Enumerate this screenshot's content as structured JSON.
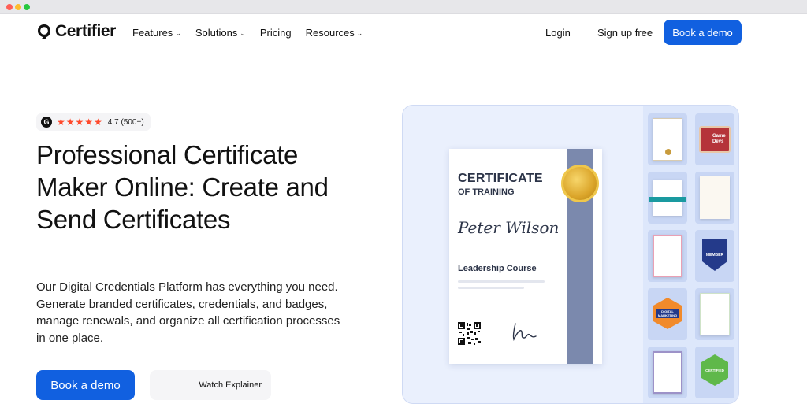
{
  "browser": {
    "dots": [
      "#ff5f57",
      "#febc2e",
      "#28c840"
    ]
  },
  "nav": {
    "logo_text": "Certifier",
    "menu": [
      {
        "label": "Features",
        "has_dropdown": true
      },
      {
        "label": "Solutions",
        "has_dropdown": true
      },
      {
        "label": "Pricing",
        "has_dropdown": false
      },
      {
        "label": "Resources",
        "has_dropdown": true
      }
    ],
    "login": "Login",
    "signup": "Sign up free",
    "cta": "Book a demo"
  },
  "hero": {
    "rating": {
      "badge": "G",
      "stars": 5,
      "text": "4.7 (500+)"
    },
    "headline": "Professional Certificate Maker Online: Create and Send Certificates",
    "subtext": "Our Digital Credentials Platform has everything you need. Generate branded certificates, credentials, and badges, manage renewals, and organize all certification processes in one place.",
    "primary_button": "Book a demo",
    "secondary_button": "Watch Explainer"
  },
  "certificate": {
    "title": "CERTIFICATE",
    "subtitle": "OF TRAINING",
    "recipient": "Peter Wilson",
    "course": "Leadership Course"
  },
  "thumbnails": {
    "game_devs_badge": "Game Devs",
    "member_badge": "MEMBER",
    "certified_badge": "CERTIFIED",
    "digital_marketing_badge": "DIGITAL MARKETING"
  },
  "colors": {
    "accent": "#1160e0",
    "star": "#ff492c",
    "stripe": "#7b89ad",
    "panel": "#eaf0fd"
  }
}
